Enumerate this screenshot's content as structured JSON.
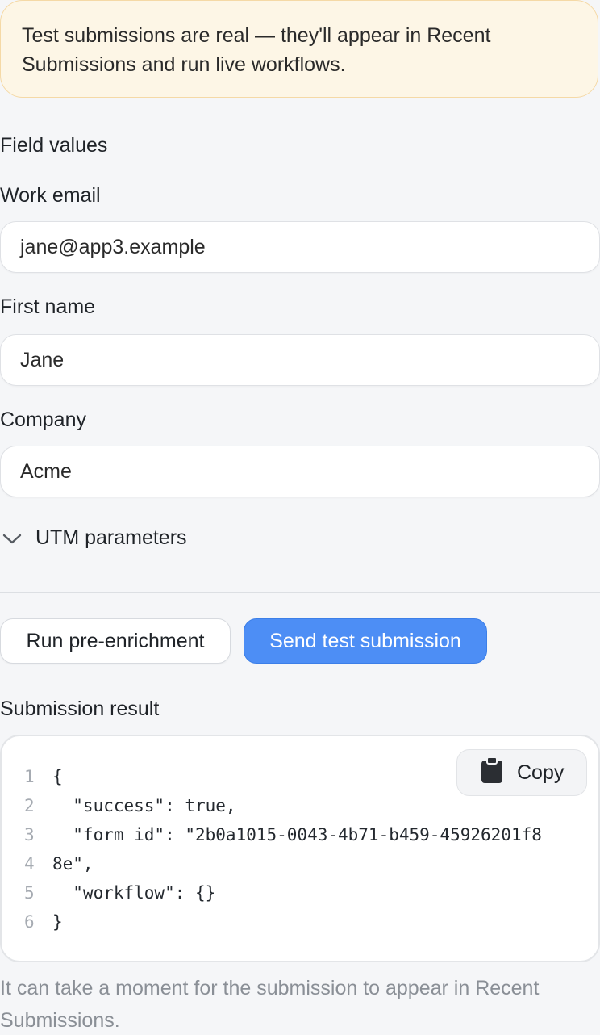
{
  "notice": {
    "text": "Test submissions are real — they'll appear in Recent Submissions and run live workflows."
  },
  "field_values": {
    "title": "Field values",
    "fields": [
      {
        "label": "Work email",
        "value": "jane@app3.example"
      },
      {
        "label": "First name",
        "value": "Jane"
      },
      {
        "label": "Company",
        "value": "Acme"
      }
    ]
  },
  "utm": {
    "label": "UTM parameters",
    "icon": "chevron-down-icon"
  },
  "actions": {
    "pre_enrichment_label": "Run pre-enrichment",
    "send_label": "Send test submission",
    "primary_color": "#4d8ef5"
  },
  "result": {
    "title": "Submission result",
    "copy_label": "Copy",
    "copy_icon": "clipboard-icon",
    "lines": [
      {
        "n": "1",
        "text": "{"
      },
      {
        "n": "2",
        "text": "  \"success\": true,"
      },
      {
        "n": "3",
        "text": "  \"form_id\": \"2b0a1015-0043-4b71-b459-45926201f8"
      },
      {
        "n": "4",
        "text": "8e\","
      },
      {
        "n": "5",
        "text": "  \"workflow\": {}"
      },
      {
        "n": "6",
        "text": "}"
      }
    ]
  },
  "footnote": "It can take a moment for the submission to appear in Recent Submissions."
}
